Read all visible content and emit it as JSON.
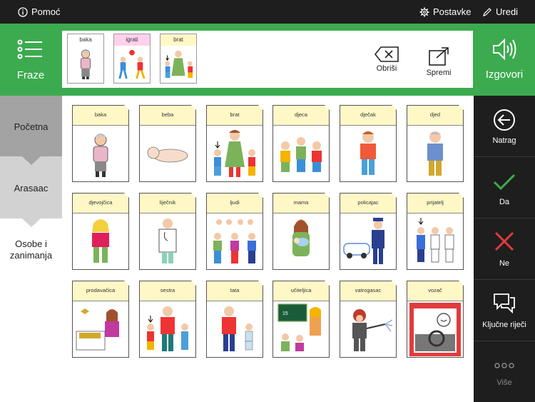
{
  "topbar": {
    "help_label": "Pomoć",
    "settings_label": "Postavke",
    "edit_label": "Uredi"
  },
  "phrase_bar": {
    "phrases_label": "Fraze",
    "clear_label": "Obriši",
    "save_label": "Spremi",
    "speak_label": "Izgovori",
    "message": [
      {
        "word": "baka",
        "header_color": "#ffffff"
      },
      {
        "word": "igrati",
        "header_color": "#ffd1ec"
      },
      {
        "word": "brat",
        "header_color": "#fff8c6"
      }
    ]
  },
  "categories": [
    {
      "label": "Početna"
    },
    {
      "label": "Arasaac"
    },
    {
      "label": "Osobe i zanimanja"
    }
  ],
  "grid": {
    "cards": [
      {
        "word": "baka"
      },
      {
        "word": "beba"
      },
      {
        "word": "brat"
      },
      {
        "word": "djeca"
      },
      {
        "word": "dječak"
      },
      {
        "word": "djed"
      },
      {
        "word": "djevojčica"
      },
      {
        "word": "liječnik"
      },
      {
        "word": "ljudi"
      },
      {
        "word": "mama"
      },
      {
        "word": "policajac"
      },
      {
        "word": "prijatelj"
      },
      {
        "word": "prodavačica"
      },
      {
        "word": "sestra"
      },
      {
        "word": "tata"
      },
      {
        "word": "učiteljica"
      },
      {
        "word": "vatrogasac"
      },
      {
        "word": "vozač"
      }
    ]
  },
  "right_panel": {
    "back_label": "Natrag",
    "yes_label": "Da",
    "no_label": "Ne",
    "keywords_label": "Ključne riječi",
    "more_label": "Više"
  },
  "colors": {
    "brand_green": "#3cab4f",
    "card_header": "#fff8c6",
    "yes_green": "#3cab4f",
    "no_red": "#e23b3b",
    "dark_bg": "#1e1e1e"
  }
}
